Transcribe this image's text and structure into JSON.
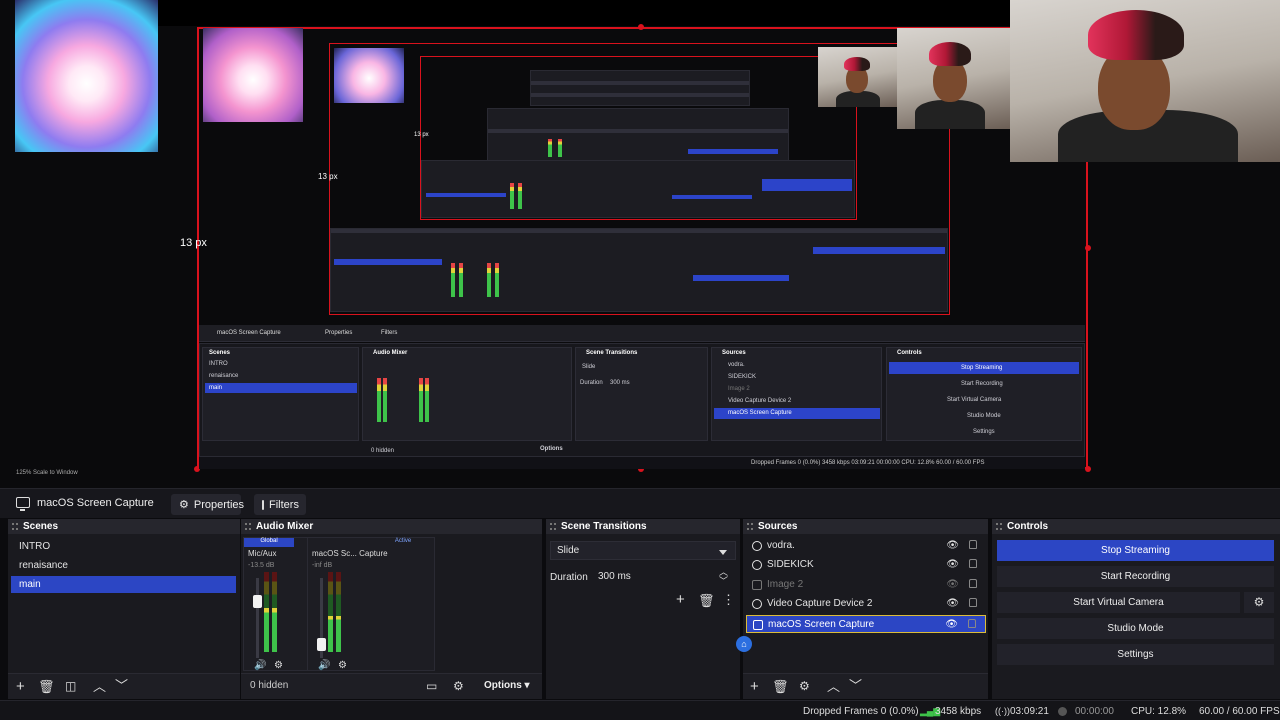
{
  "preview": {
    "labels": [
      "13 px",
      "13 px",
      "13 px"
    ],
    "nested": {
      "source_name": "macOS Screen Capture",
      "properties": "Properties",
      "filters": "Filters",
      "headers": [
        "Scenes",
        "Audio Mixer",
        "Scene Transitions",
        "Sources",
        "Controls"
      ],
      "scenes": [
        "INTRO",
        "renaisance",
        "main"
      ],
      "sources": [
        "vodra.",
        "SIDEKICK",
        "Image 2",
        "Video Capture Device 2",
        "macOS Screen Capture"
      ],
      "controls": [
        "Stop Streaming",
        "Start Recording",
        "Start Virtual Camera",
        "Studio Mode",
        "Settings"
      ],
      "transition": "Slide",
      "duration_label": "Duration",
      "duration": "300 ms",
      "hidden": "0 hidden",
      "options": "Options",
      "status": "Dropped Frames 0 (0.0%)   3458 kbps   03:09:21   00:00:00   CPU: 12.8%   60.00 / 60.00 FPS",
      "zoom": "125%   Scale to Window"
    }
  },
  "source_toolbar": {
    "source_name": "macOS Screen Capture",
    "properties_label": "Properties",
    "filters_label": "Filters"
  },
  "scenes": {
    "title": "Scenes",
    "items": [
      "INTRO",
      "renaisance",
      "main"
    ],
    "selected": "main"
  },
  "mixer": {
    "title": "Audio Mixer",
    "channels": [
      {
        "badge": "Global",
        "label": "Mic/Aux",
        "db": "-13.5 dB",
        "level": 0.55,
        "fader": 0.75
      },
      {
        "badge": "Active",
        "label": "macOS Sc... Capture",
        "db": "-inf dB",
        "level": 0.45,
        "fader": 0.1
      }
    ],
    "hidden_label": "0 hidden",
    "options_label": "Options"
  },
  "transitions": {
    "title": "Scene Transitions",
    "selected": "Slide",
    "duration_label": "Duration",
    "duration_value": "300 ms"
  },
  "sources": {
    "title": "Sources",
    "items": [
      {
        "name": "vodra.",
        "icon": "scene-icon",
        "dim": false,
        "selected": false
      },
      {
        "name": "SIDEKICK",
        "icon": "scene-icon",
        "dim": false,
        "selected": false
      },
      {
        "name": "Image 2",
        "icon": "image-icon",
        "dim": true,
        "selected": false
      },
      {
        "name": "Video Capture Device 2",
        "icon": "camera-icon",
        "dim": false,
        "selected": false
      },
      {
        "name": "macOS Screen Capture",
        "icon": "monitor-icon",
        "dim": false,
        "selected": true
      }
    ]
  },
  "controls": {
    "title": "Controls",
    "stop_streaming": "Stop Streaming",
    "start_recording": "Start Recording",
    "start_virtual_camera": "Start Virtual Camera",
    "studio_mode": "Studio Mode",
    "settings": "Settings"
  },
  "statusbar": {
    "dropped": "Dropped Frames 0 (0.0%)",
    "kbps": "3458 kbps",
    "stream_time": "03:09:21",
    "rec_time": "00:00:00",
    "cpu": "CPU: 12.8%",
    "fps": "60.00 / 60.00 FPS"
  },
  "colors": {
    "accent": "#2c46c4",
    "live": "#3ec34a",
    "frame": "#d9121d"
  }
}
